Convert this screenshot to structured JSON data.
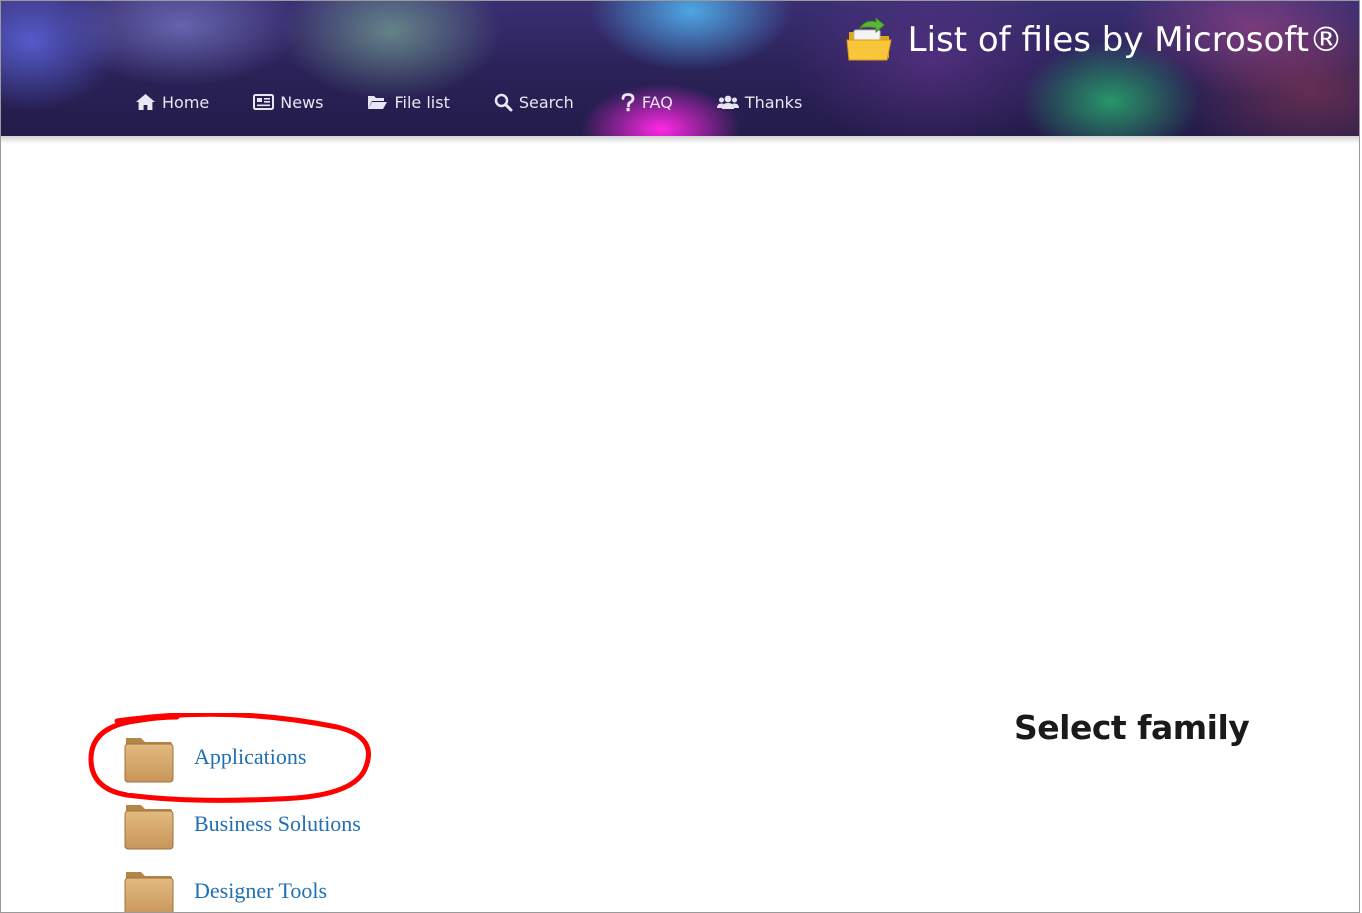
{
  "header": {
    "title": "List of files by Microsoft®",
    "logo_icon": "folder-download-icon"
  },
  "nav": {
    "items": [
      {
        "label": "Home",
        "icon": "home-icon"
      },
      {
        "label": "News",
        "icon": "newspaper-icon"
      },
      {
        "label": "File list",
        "icon": "folder-open-icon"
      },
      {
        "label": "Search",
        "icon": "search-icon"
      },
      {
        "label": "FAQ",
        "icon": "question-icon"
      },
      {
        "label": "Thanks",
        "icon": "users-icon"
      }
    ]
  },
  "main": {
    "heading": "Select family",
    "families": [
      {
        "label": "Applications",
        "icon": "folder-icon"
      },
      {
        "label": "Business Solutions",
        "icon": "folder-icon"
      },
      {
        "label": "Designer Tools",
        "icon": "folder-icon"
      }
    ],
    "annotation_color": "#ff0000",
    "link_color": "#1f6fb2"
  }
}
